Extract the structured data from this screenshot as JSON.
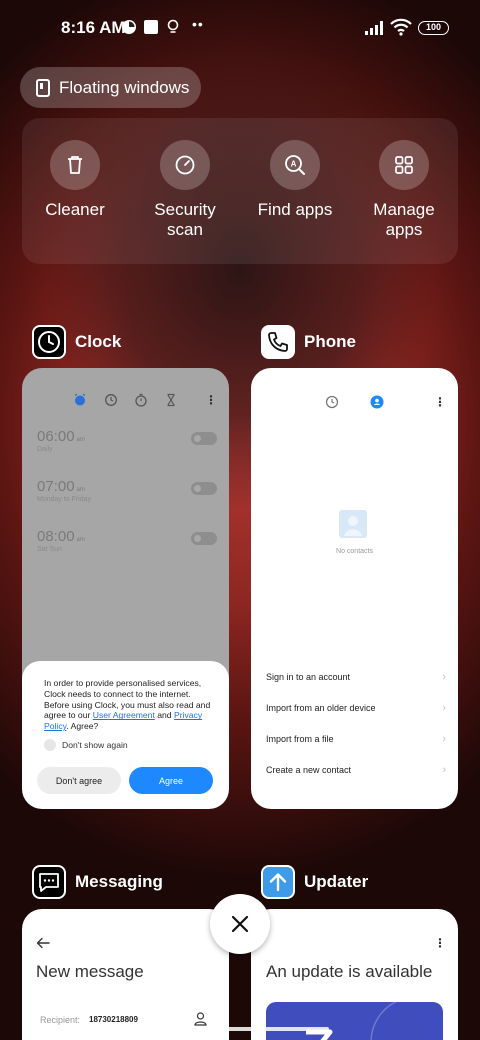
{
  "status_bar": {
    "time": "8:16 AM",
    "dots": "••",
    "battery": "100"
  },
  "floating_windows": {
    "label": "Floating windows"
  },
  "quick_actions": [
    {
      "label": "Cleaner",
      "icon": "trash-icon"
    },
    {
      "label": "Security scan",
      "icon": "security-scan-icon"
    },
    {
      "label": "Find apps",
      "icon": "find-apps-icon"
    },
    {
      "label": "Manage apps",
      "icon": "grid-icon"
    }
  ],
  "apps": {
    "clock": {
      "name": "Clock",
      "alarms": [
        {
          "time": "06:00",
          "suffix": "am",
          "days": "Daily"
        },
        {
          "time": "07:00",
          "suffix": "am",
          "days": "Monday to Friday"
        },
        {
          "time": "08:00",
          "suffix": "am",
          "days": "Sat Sun"
        }
      ],
      "dialog": {
        "text_1": "In order to provide personalised services, Clock needs to connect to the internet. Before using Clock, you must also read and agree to our ",
        "link_1": "User Agreement",
        "text_2": " and ",
        "link_2": "Privacy Policy",
        "text_3": ". Agree?",
        "checkbox_label": "Don't show again",
        "disagree_label": "Don't agree",
        "agree_label": "Agree"
      }
    },
    "phone": {
      "name": "Phone",
      "empty_label": "No contacts",
      "actions": [
        "Sign in to an account",
        "Import from an older device",
        "Import from a file",
        "Create a new contact"
      ]
    },
    "messaging": {
      "name": "Messaging",
      "title": "New message",
      "recipient_label": "Recipient:",
      "recipient_value": "18730218809"
    },
    "updater": {
      "name": "Updater",
      "title": "An update is available"
    }
  },
  "colors": {
    "accent_blue": "#1e88ff",
    "updater_icon": "#3d9be8",
    "update_banner": "#3f4dbd"
  }
}
